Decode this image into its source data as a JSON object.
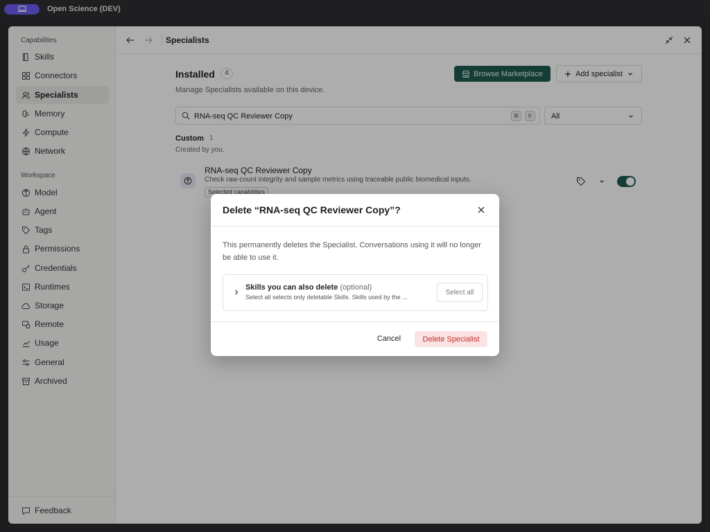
{
  "app": {
    "title": "Open Science (DEV)"
  },
  "sidebar": {
    "capabilities_title": "Capabilities",
    "capabilities": [
      {
        "label": "Skills",
        "icon": "book-icon"
      },
      {
        "label": "Connectors",
        "icon": "grid-icon"
      },
      {
        "label": "Specialists",
        "icon": "users-icon",
        "active": true
      },
      {
        "label": "Memory",
        "icon": "brain-icon"
      },
      {
        "label": "Compute",
        "icon": "lightning-icon"
      },
      {
        "label": "Network",
        "icon": "globe-icon"
      }
    ],
    "workspace_title": "Workspace",
    "workspace": [
      {
        "label": "Model",
        "icon": "model-icon"
      },
      {
        "label": "Agent",
        "icon": "agent-icon"
      },
      {
        "label": "Tags",
        "icon": "tag-icon"
      },
      {
        "label": "Permissions",
        "icon": "lock-icon"
      },
      {
        "label": "Credentials",
        "icon": "key-icon"
      },
      {
        "label": "Runtimes",
        "icon": "terminal-icon"
      },
      {
        "label": "Storage",
        "icon": "cloud-icon"
      },
      {
        "label": "Remote",
        "icon": "remote-icon"
      },
      {
        "label": "Usage",
        "icon": "chart-icon"
      },
      {
        "label": "General",
        "icon": "sliders-icon"
      },
      {
        "label": "Archived",
        "icon": "archive-icon"
      }
    ],
    "feedback": "Feedback"
  },
  "topbar": {
    "breadcrumb": "Specialists"
  },
  "main": {
    "installed_title": "Installed",
    "installed_count": "4",
    "installed_subtitle": "Manage Specialists available on this device.",
    "browse_label": "Browse Marketplace",
    "add_label": "Add specialist",
    "search_value": "RNA-seq QC Reviewer Copy",
    "kbd_1": "⌘",
    "kbd_2": "K",
    "filter_value": "All",
    "custom_title": "Custom",
    "custom_count": "1",
    "custom_subtitle": "Created by you.",
    "specialist": {
      "name": "RNA-seq QC Reviewer Copy",
      "description": "Check raw-count integrity and sample metrics using traceable public biomedical inputs.",
      "tag": "Selected capabilities",
      "enabled": true
    }
  },
  "dialog": {
    "title": "Delete “RNA-seq QC Reviewer Copy”?",
    "body": "This permanently deletes the Specialist. Conversations using it will no longer be able to use it.",
    "skills_title": "Skills you can also delete",
    "skills_optional": "(optional)",
    "skills_subtitle": "Select all selects only deletable Skills. Skills used by the ...",
    "select_all": "Select all",
    "cancel": "Cancel",
    "delete": "Delete Specialist"
  },
  "colors": {
    "accent": "#1e5c4e",
    "danger": "#c42d2d",
    "app_pill": "#6b5cf0"
  }
}
